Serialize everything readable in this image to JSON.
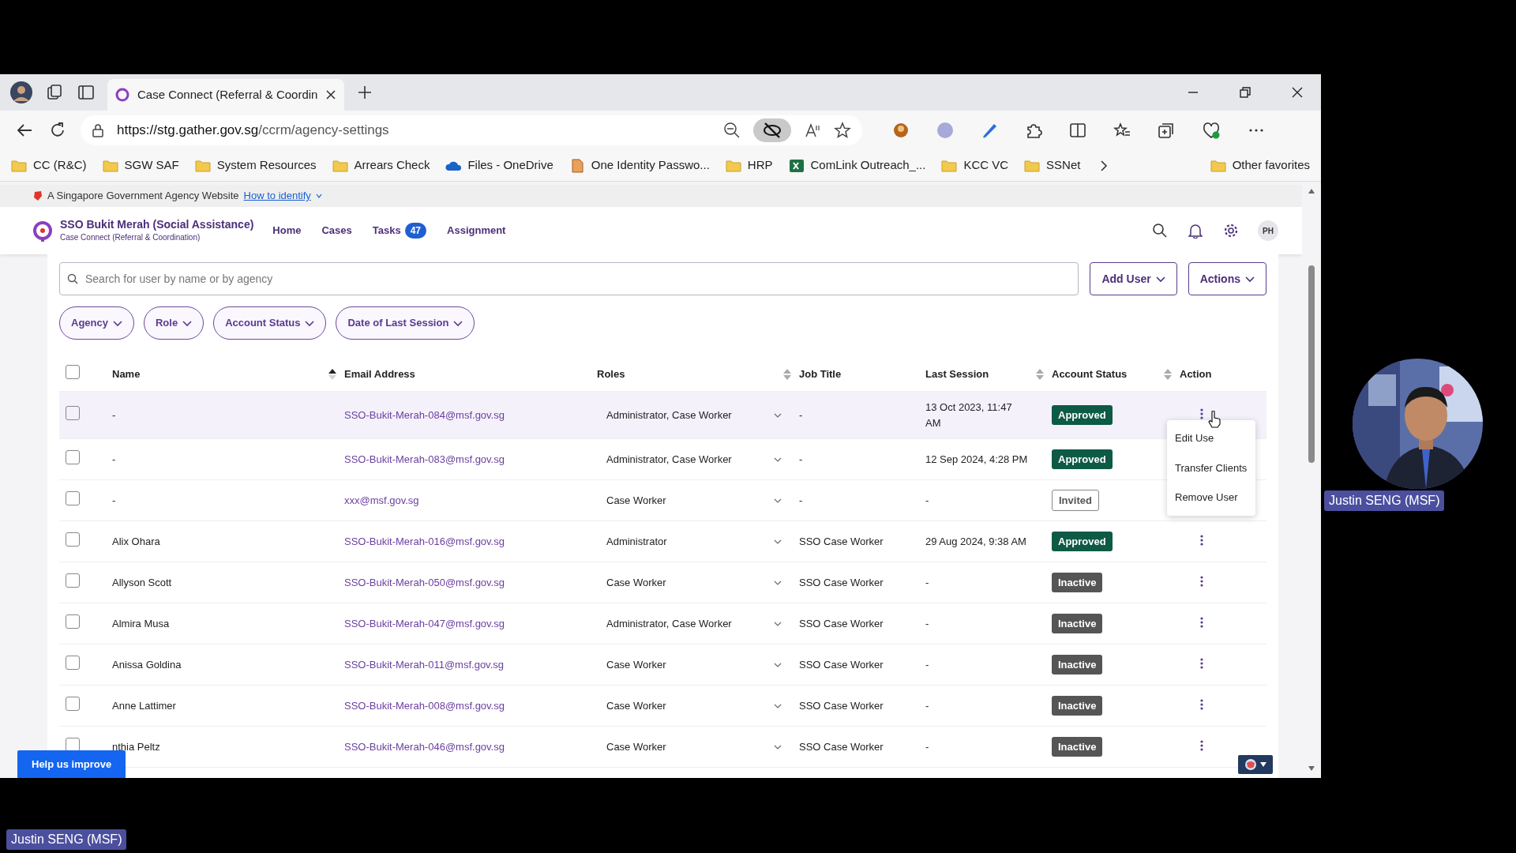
{
  "browser": {
    "tab_title": "Case Connect (Referral & Coordin",
    "url_host": "https://stg.gather.gov.sg",
    "url_path": "/ccrm/agency-settings",
    "bookmarks": [
      {
        "label": "CC (R&C)",
        "kind": "folder"
      },
      {
        "label": "SGW SAF",
        "kind": "folder"
      },
      {
        "label": "System Resources",
        "kind": "folder"
      },
      {
        "label": "Arrears Check",
        "kind": "folder"
      },
      {
        "label": "Files - OneDrive",
        "kind": "cloud"
      },
      {
        "label": "One Identity Passwo...",
        "kind": "page"
      },
      {
        "label": "HRP",
        "kind": "folder"
      },
      {
        "label": "ComLink Outreach_...",
        "kind": "sheet"
      },
      {
        "label": "KCC VC",
        "kind": "folder"
      },
      {
        "label": "SSNet",
        "kind": "folder"
      }
    ],
    "other_favorites": "Other favorites"
  },
  "gov_banner": {
    "text": "A Singapore Government Agency Website",
    "link": "How to identify"
  },
  "app_header": {
    "agency": "SSO Bukit Merah (Social Assistance)",
    "product": "Case Connect (Referral & Coordination)",
    "nav": [
      {
        "label": "Home"
      },
      {
        "label": "Cases"
      },
      {
        "label": "Tasks",
        "count": "47"
      },
      {
        "label": "Assignment"
      }
    ],
    "avatar": "PH"
  },
  "search": {
    "placeholder": "Search for user by name or by agency"
  },
  "buttons": [
    "Add User",
    "Actions"
  ],
  "filters": [
    "Agency",
    "Role",
    "Account Status",
    "Date of Last Session"
  ],
  "table": {
    "header_checked": false,
    "columns": [
      {
        "label": "Name",
        "sortable": true,
        "sorted": true
      },
      {
        "label": "Email Address",
        "sortable": false
      },
      {
        "label": "Roles",
        "sortable": true,
        "sorted": false
      },
      {
        "label": "Job Title",
        "sortable": false
      },
      {
        "label": "Last Session",
        "sortable": true,
        "sorted": false
      },
      {
        "label": "Account Status",
        "sortable": true,
        "sorted": false
      },
      {
        "label": "Action",
        "sortable": false
      }
    ],
    "rows": [
      {
        "name": "-",
        "email": "SSO-Bukit-Merah-084@msf.gov.sg",
        "roles": "Administrator, Case Worker",
        "job_title": "-",
        "last_session": "13 Oct 2023, 11:47 AM",
        "status": "Approved",
        "kind": "approved",
        "checked": false,
        "selected": true
      },
      {
        "name": "-",
        "email": "SSO-Bukit-Merah-083@msf.gov.sg",
        "roles": "Administrator, Case Worker",
        "job_title": "-",
        "last_session": "12 Sep 2024, 4:28 PM",
        "status": "Approved",
        "kind": "approved",
        "checked": false,
        "selected": false
      },
      {
        "name": "-",
        "email": "xxx@msf.gov.sg",
        "roles": "Case Worker",
        "job_title": "-",
        "last_session": "-",
        "status": "Invited",
        "kind": "invited",
        "checked": false,
        "selected": false
      },
      {
        "name": "Alix Ohara",
        "email": "SSO-Bukit-Merah-016@msf.gov.sg",
        "roles": "Administrator",
        "job_title": "SSO Case Worker",
        "last_session": "29 Aug 2024, 9:38 AM",
        "status": "Approved",
        "kind": "approved",
        "checked": false,
        "selected": false
      },
      {
        "name": "Allyson Scott",
        "email": "SSO-Bukit-Merah-050@msf.gov.sg",
        "roles": "Case Worker",
        "job_title": "SSO Case Worker",
        "last_session": "-",
        "status": "Inactive",
        "kind": "inactive",
        "checked": false,
        "selected": false
      },
      {
        "name": "Almira Musa",
        "email": "SSO-Bukit-Merah-047@msf.gov.sg",
        "roles": "Administrator, Case Worker",
        "job_title": "SSO Case Worker",
        "last_session": "-",
        "status": "Inactive",
        "kind": "inactive",
        "checked": false,
        "selected": false
      },
      {
        "name": "Anissa Goldina",
        "email": "SSO-Bukit-Merah-011@msf.gov.sg",
        "roles": "Case Worker",
        "job_title": "SSO Case Worker",
        "last_session": "-",
        "status": "Inactive",
        "kind": "inactive",
        "checked": false,
        "selected": false
      },
      {
        "name": "Anne Lattimer",
        "email": "SSO-Bukit-Merah-008@msf.gov.sg",
        "roles": "Case Worker",
        "job_title": "SSO Case Worker",
        "last_session": "-",
        "status": "Inactive",
        "kind": "inactive",
        "checked": false,
        "selected": false
      },
      {
        "name": "nthia Peltz",
        "email": "SSO-Bukit-Merah-046@msf.gov.sg",
        "roles": "Case Worker",
        "job_title": "SSO Case Worker",
        "last_session": "-",
        "status": "Inactive",
        "kind": "inactive",
        "checked": false,
        "selected": false
      }
    ]
  },
  "action_menu": {
    "items": [
      "Edit Use",
      "Transfer Clients",
      "Remove User"
    ]
  },
  "help_button": "Help us improve",
  "video": {
    "participant": "Justin SENG (MSF)",
    "self_label": "Justin SENG (MSF)"
  }
}
